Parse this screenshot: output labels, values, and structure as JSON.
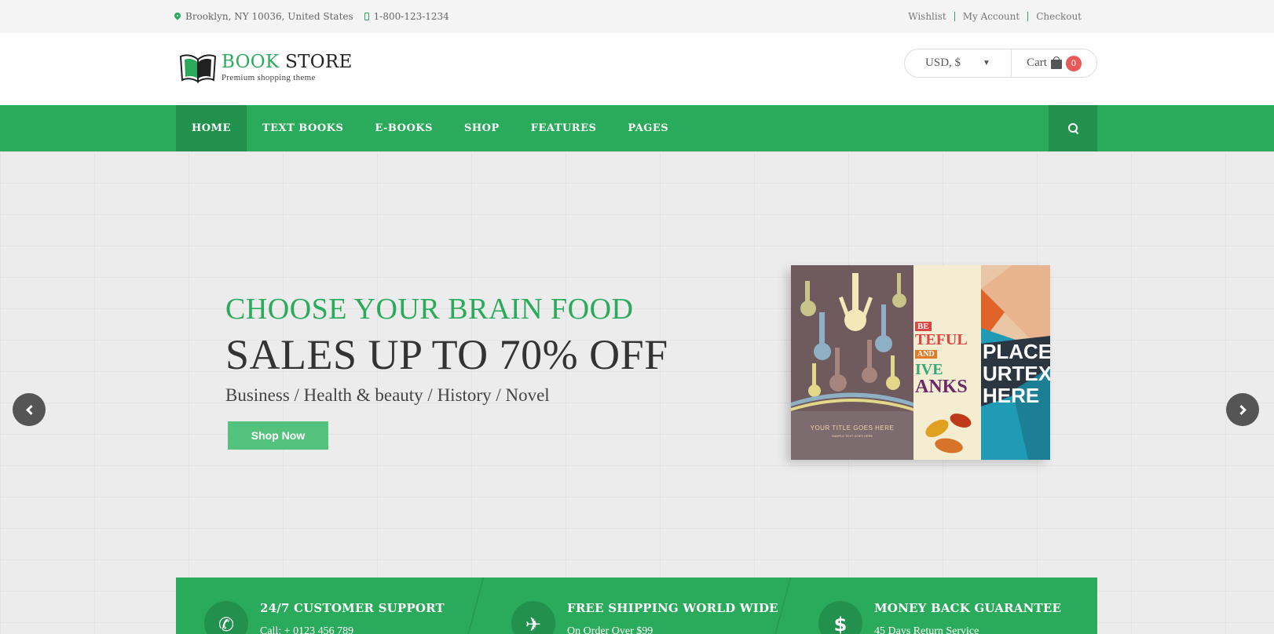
{
  "topbar": {
    "address": "Brooklyn, NY 10036, United States",
    "phone": "1-800-123-1234",
    "links": [
      "Wishlist",
      "My Account",
      "Checkout"
    ]
  },
  "header": {
    "logo_word1": "BOOK",
    "logo_word2": "STORE",
    "tagline": "Premium shopping theme",
    "currency": "USD, $",
    "cart_label": "Cart",
    "cart_count": "0"
  },
  "nav": {
    "items": [
      "HOME",
      "TEXT BOOKS",
      "E-BOOKS",
      "SHOP",
      "FEATURES",
      "PAGES"
    ]
  },
  "hero": {
    "kicker": "CHOOSE YOUR BRAIN FOOD",
    "headline": "SALES UP TO 70% OFF",
    "subtitle": "Business / Health & beauty / History / Novel",
    "button": "Shop Now",
    "book1_caption": "YOUR TITLE GOES HERE",
    "book1_sub": "SAMPLE TEXT GOES HERE",
    "book2_lines": [
      "BE",
      "TEFUL",
      "AND",
      "IVE",
      "ANKS"
    ],
    "book3_lines": [
      "PLACE",
      "URTEXT",
      "HERE"
    ]
  },
  "features": [
    {
      "title": "24/7 CUSTOMER SUPPORT",
      "sub": "Call: + 0123 456 789",
      "icon": "phone-icon"
    },
    {
      "title": "FREE SHIPPING WORLD WIDE",
      "sub": "On Order Over $99",
      "icon": "plane-icon"
    },
    {
      "title": "MONEY BACK GUARANTEE",
      "sub": "45 Days Return Service",
      "icon": "dollar-icon"
    }
  ],
  "colors": {
    "accent": "#2aaa5b",
    "accent_dark": "#23914e",
    "badge": "#e85a5a"
  }
}
